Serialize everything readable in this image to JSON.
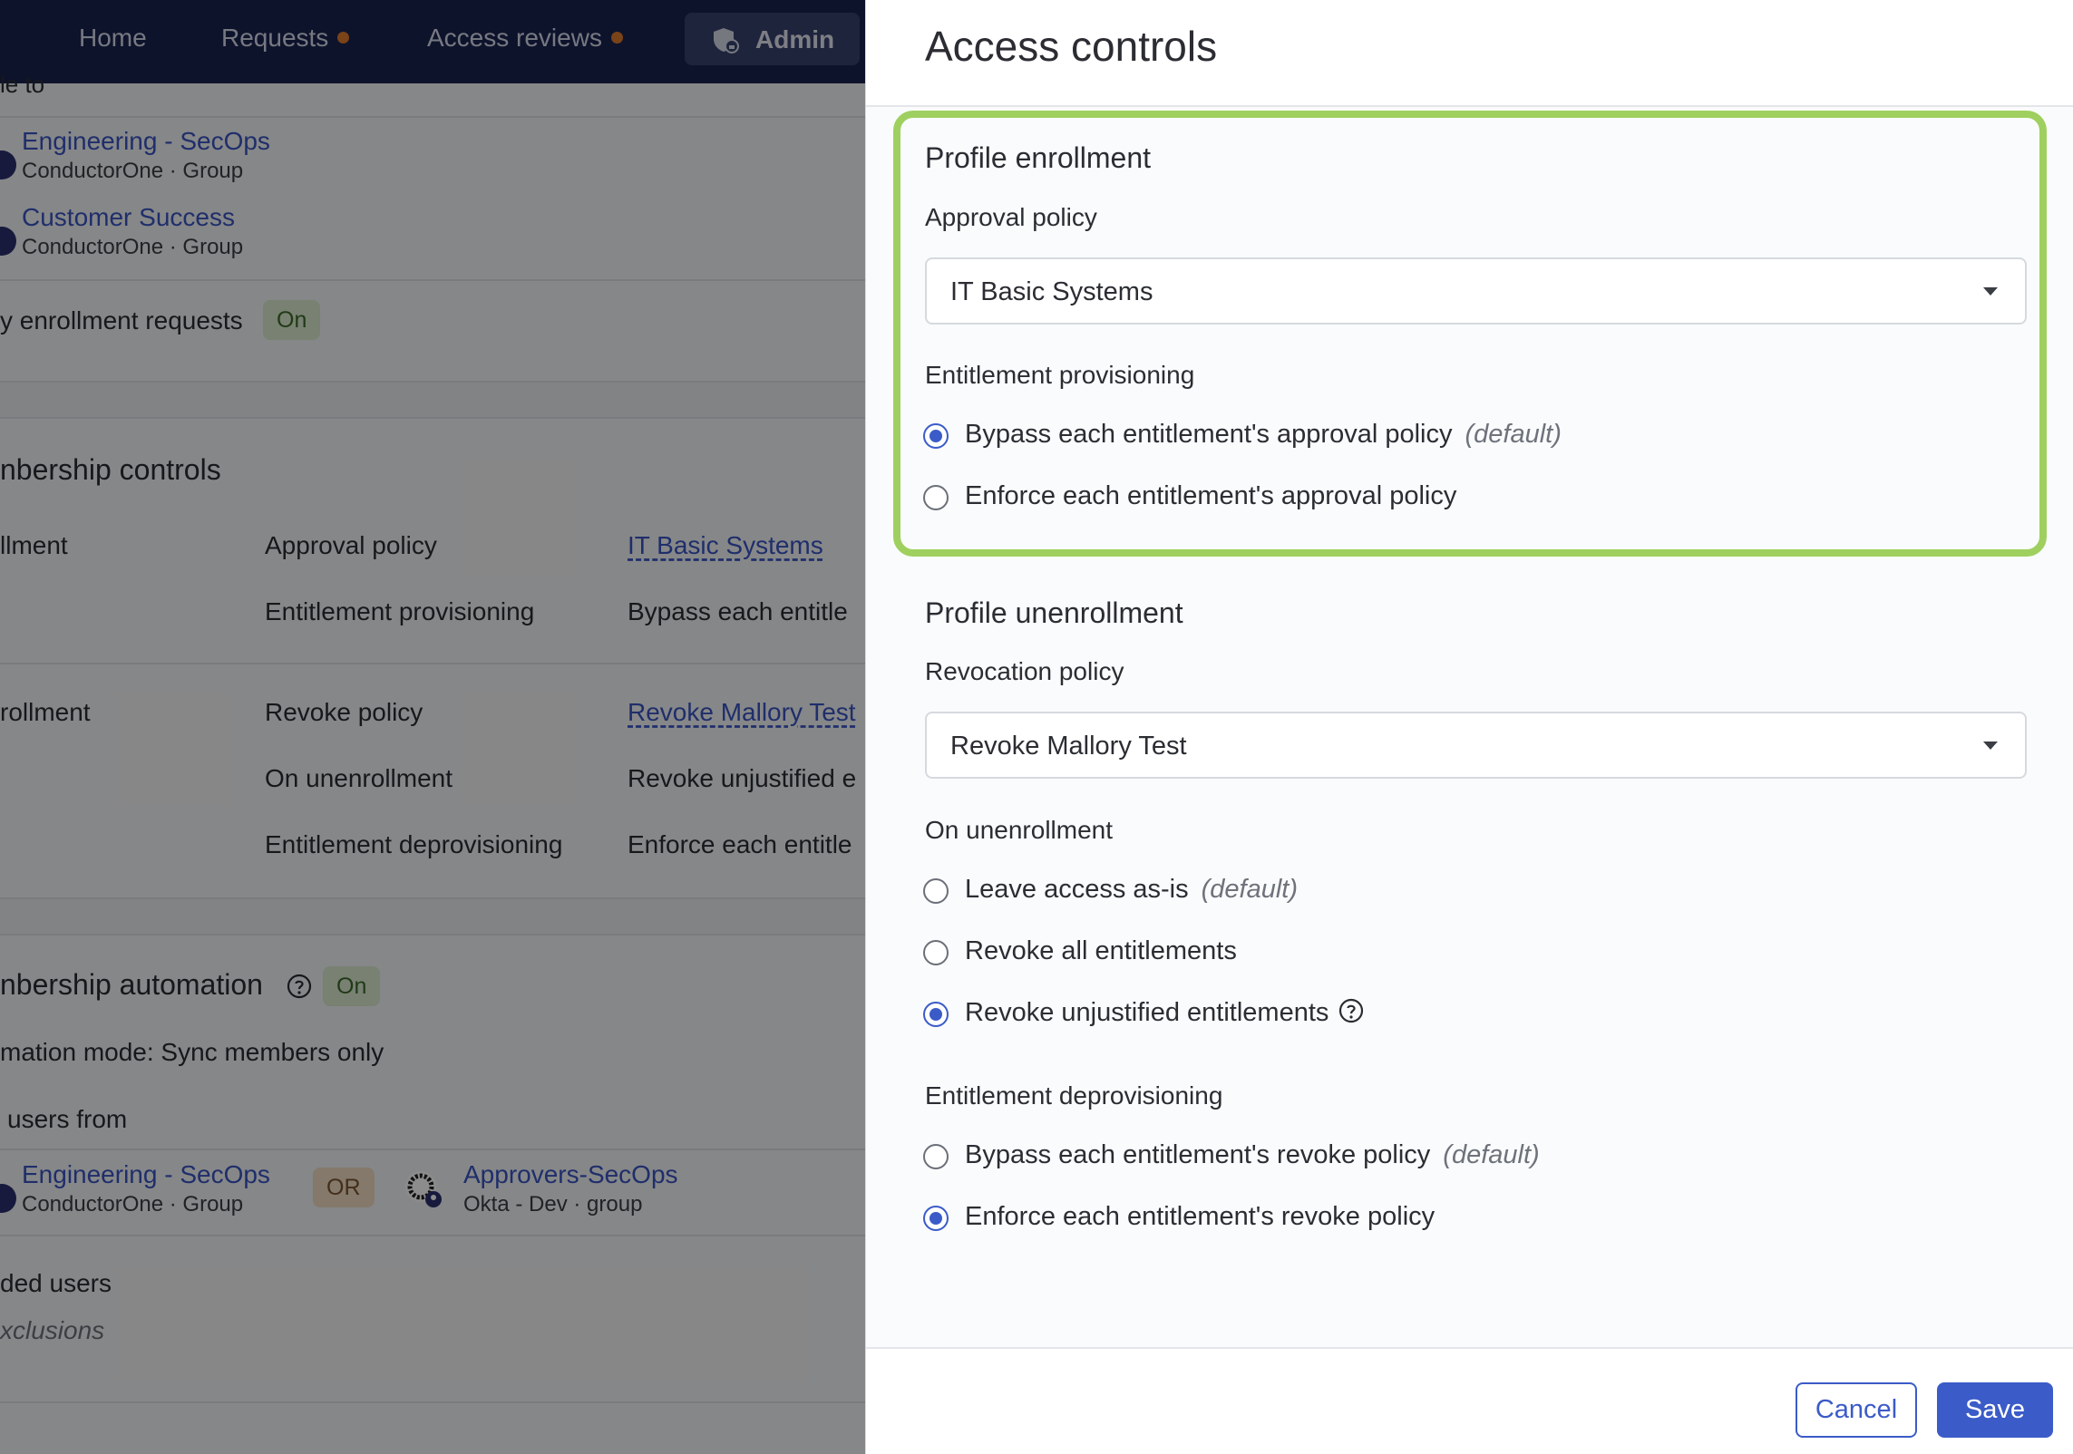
{
  "nav": {
    "home": "Home",
    "requests": "Requests",
    "access_reviews": "Access reviews",
    "admin": "Admin"
  },
  "background": {
    "truncated_header": "le to",
    "groups": [
      {
        "name": "Engineering - SecOps",
        "app": "ConductorOne",
        "type": "Group"
      },
      {
        "name": "Customer Success",
        "app": "ConductorOne",
        "type": "Group"
      }
    ],
    "enrollment_requests_label": "enrollment requests",
    "enrollment_requests_status": "On",
    "membership_controls_title": "nbership controls",
    "enrollment_label": "llment",
    "approval_policy_label": "Approval policy",
    "approval_policy_value": "IT Basic Systems",
    "entitlement_provisioning_label": "Entitlement provisioning",
    "entitlement_provisioning_value": "Bypass each entitle",
    "unenrollment_label": "rollment",
    "revoke_policy_label": "Revoke policy",
    "revoke_policy_value": "Revoke Mallory Test",
    "on_unenrollment_label": "On unenrollment",
    "on_unenrollment_value": "Revoke unjustified e",
    "entitlement_deprovisioning_label": "Entitlement deprovisioning",
    "entitlement_deprovisioning_value": "Enforce each entitle",
    "automation_title": "nbership automation",
    "automation_status": "On",
    "automation_mode": "mation mode: Sync members only",
    "users_from_label": "users from",
    "source_group": {
      "name": "Engineering - SecOps",
      "app": "ConductorOne",
      "type": "Group"
    },
    "or_label": "OR",
    "okta_group": {
      "name": "Approvers-SecOps",
      "app": "Okta - Dev",
      "type": "group"
    },
    "excluded_users_label": "ded users",
    "exclusions_text": "xclusions"
  },
  "drawer": {
    "title": "Access controls",
    "enrollment": {
      "title": "Profile enrollment",
      "approval_policy_label": "Approval policy",
      "approval_policy_value": "IT Basic Systems",
      "provisioning_label": "Entitlement provisioning",
      "options": [
        {
          "label": "Bypass each entitlement's approval policy",
          "default": "(default)",
          "selected": true
        },
        {
          "label": "Enforce each entitlement's approval policy",
          "default": "",
          "selected": false
        }
      ]
    },
    "unenrollment": {
      "title": "Profile unenrollment",
      "revocation_policy_label": "Revocation policy",
      "revocation_policy_value": "Revoke Mallory Test",
      "on_unenrollment_label": "On unenrollment",
      "on_unenrollment_options": [
        {
          "label": "Leave access as-is",
          "default": "(default)",
          "selected": false
        },
        {
          "label": "Revoke all entitlements",
          "default": "",
          "selected": false
        },
        {
          "label": "Revoke unjustified entitlements",
          "default": "",
          "selected": true
        }
      ],
      "deprovisioning_label": "Entitlement deprovisioning",
      "deprovisioning_options": [
        {
          "label": "Bypass each entitlement's revoke policy",
          "default": "(default)",
          "selected": false
        },
        {
          "label": "Enforce each entitlement's revoke policy",
          "default": "",
          "selected": true
        }
      ]
    },
    "cancel_label": "Cancel",
    "save_label": "Save"
  },
  "colors": {
    "nav_bg": "#1a2350",
    "accent": "#3b5bc8",
    "highlight": "#9fd05f",
    "notification_dot": "#e07a2c"
  }
}
